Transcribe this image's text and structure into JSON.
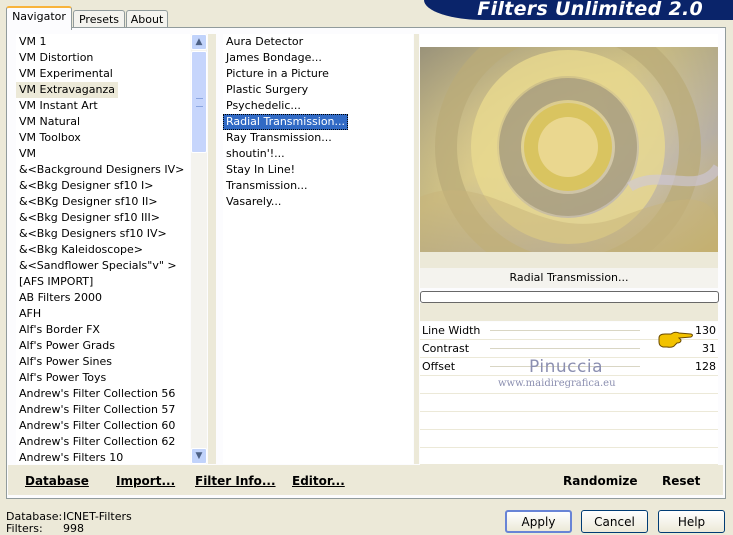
{
  "banner": {
    "title": "Filters Unlimited 2.0"
  },
  "tabs": [
    {
      "label": "Navigator",
      "active": true
    },
    {
      "label": "Presets",
      "active": false
    },
    {
      "label": "About",
      "active": false
    }
  ],
  "categories": {
    "items": [
      "VM 1",
      "VM Distortion",
      "VM Experimental",
      "VM Extravaganza",
      "VM Instant Art",
      "VM Natural",
      "VM Toolbox",
      "VM",
      "&<Background Designers IV>",
      "&<Bkg Designer sf10 I>",
      "&<BKg Designer sf10 II>",
      "&<Bkg Designer sf10 III>",
      "&<Bkg Designers sf10 IV>",
      "&<Bkg Kaleidoscope>",
      "&<Sandflower Specials\"v\" >",
      "[AFS IMPORT]",
      "AB Filters 2000",
      "AFH",
      "Alf's Border FX",
      "Alf's Power Grads",
      "Alf's Power Sines",
      "Alf's Power Toys",
      "Andrew's Filter Collection 56",
      "Andrew's Filter Collection 57",
      "Andrew's Filter Collection 60",
      "Andrew's Filter Collection 62",
      "Andrew's Filters 10"
    ],
    "selected_index": 3
  },
  "filters": {
    "items": [
      "Aura Detector",
      "James Bondage...",
      "Picture in a Picture",
      "Plastic Surgery",
      "Psychedelic...",
      "Radial Transmission...",
      "Ray Transmission...",
      "shoutin'!...",
      "Stay In Line!",
      "Transmission...",
      "Vasarely..."
    ],
    "selected_index": 5
  },
  "scrollbar": {
    "up_icon": "▲",
    "down_icon": "▼"
  },
  "bottom_links": {
    "database": "Database",
    "import": "Import...",
    "filter_info": "Filter Info...",
    "editor": "Editor...",
    "randomize": "Randomize",
    "reset": "Reset"
  },
  "preview": {
    "filter_name": "Radial Transmission...",
    "progress": 0
  },
  "params": [
    {
      "label": "Line Width",
      "value": "130"
    },
    {
      "label": "Contrast",
      "value": "31"
    },
    {
      "label": "Offset",
      "value": "128"
    }
  ],
  "watermark": {
    "line1": "Pinuccia",
    "line2": "www.maidiregrafica.eu"
  },
  "status": {
    "database_label": "Database:",
    "database_value": "ICNET-Filters",
    "filters_label": "Filters:",
    "filters_value": "998"
  },
  "buttons": {
    "apply": "Apply",
    "cancel": "Cancel",
    "help": "Help"
  },
  "colors": {
    "selection": "#316ac5",
    "banner": "#0a246a",
    "window_bg": "#ece9d8"
  }
}
